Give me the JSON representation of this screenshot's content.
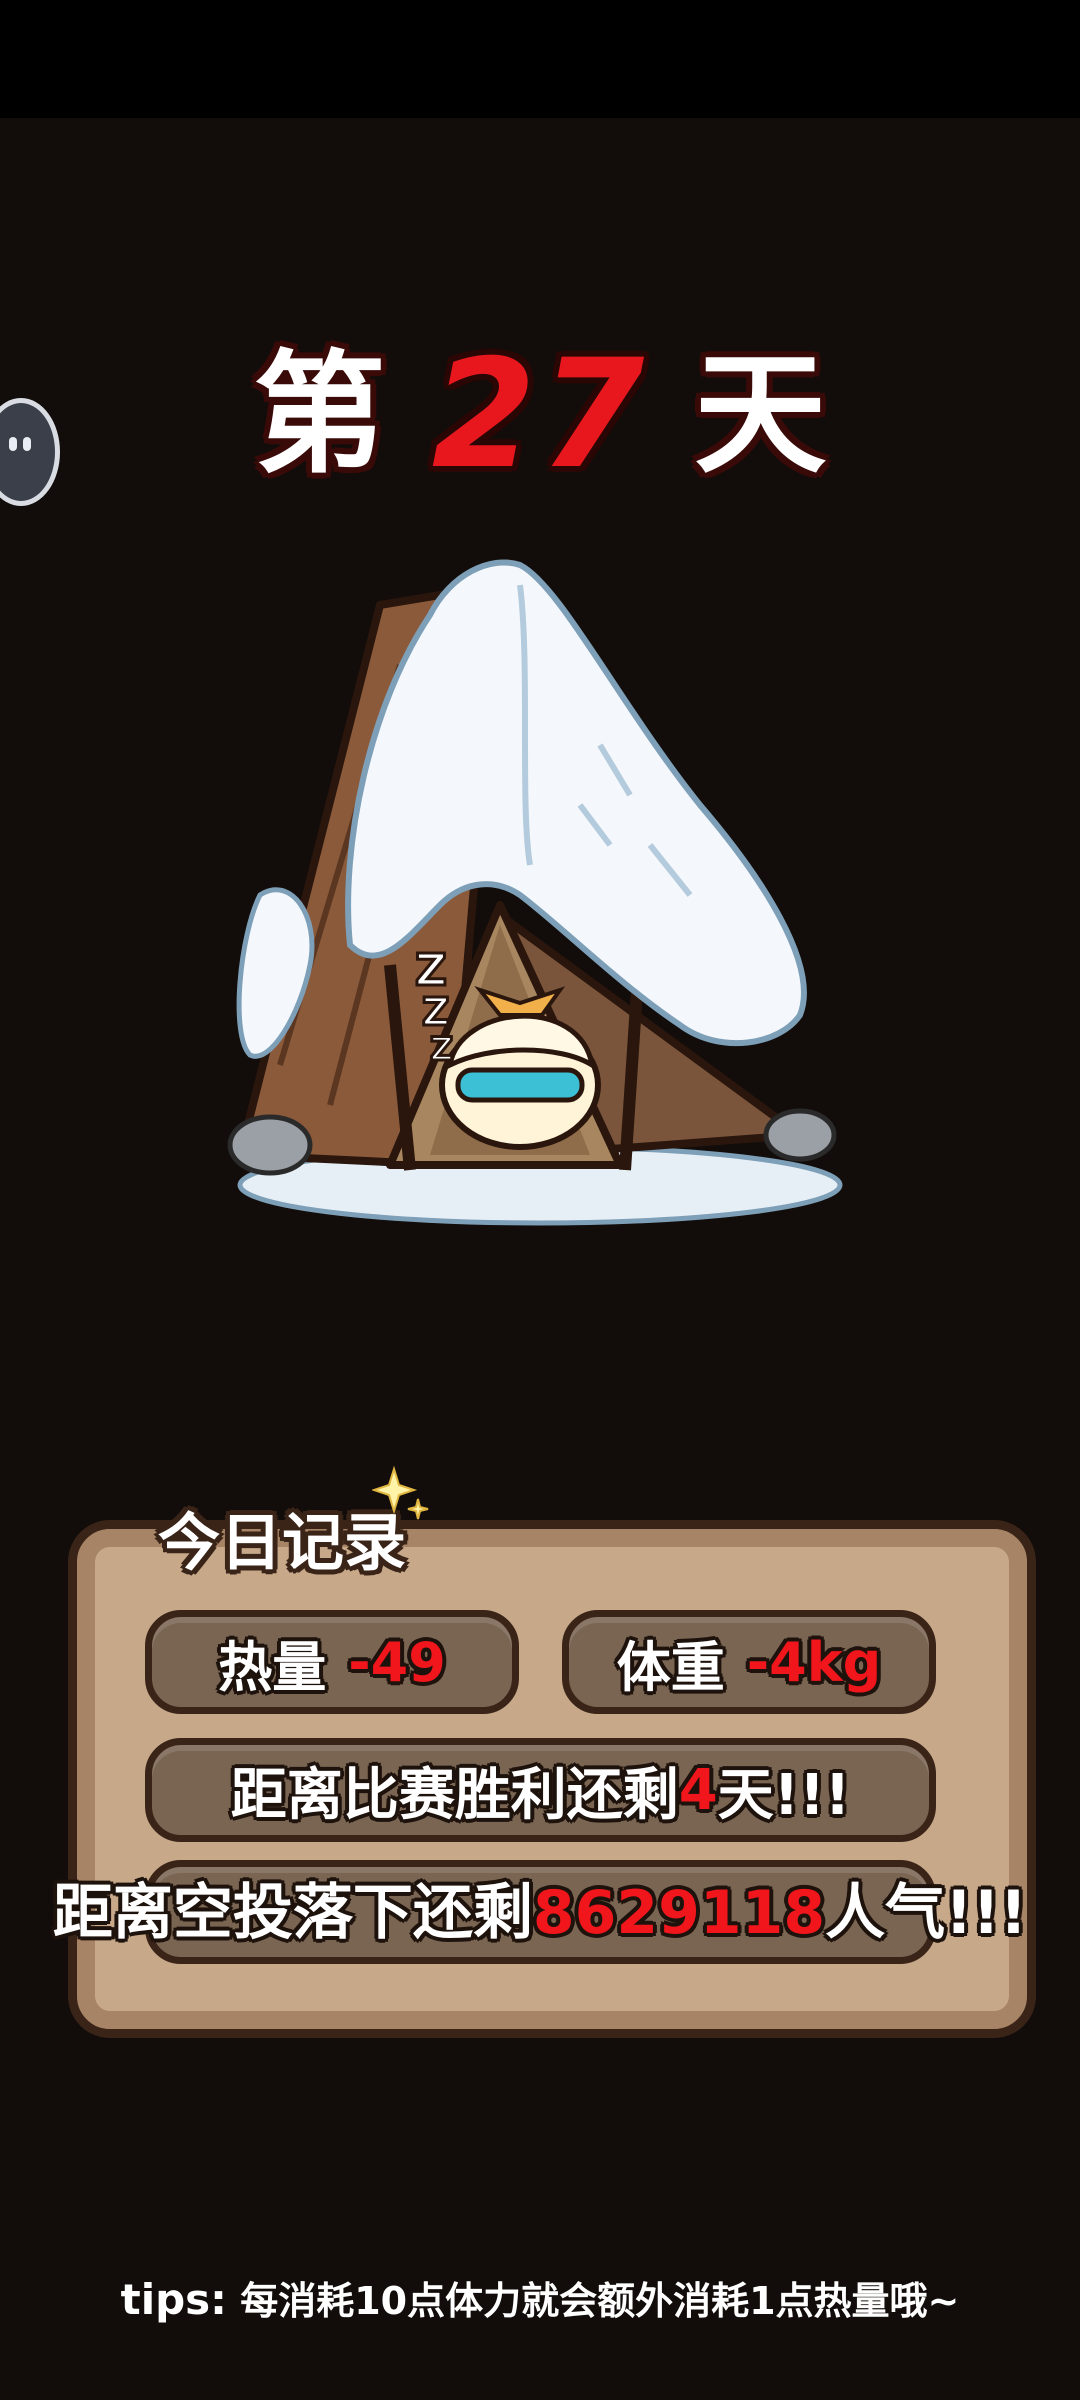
{
  "title": {
    "prefix": "第",
    "day": "27",
    "suffix": "天"
  },
  "record": {
    "heading": "今日记录",
    "calorie_label": "热量",
    "calorie_value": "-49",
    "weight_label": "体重",
    "weight_value": "-4kg",
    "victory_prefix": "距离比赛胜利还剩",
    "victory_days": "4",
    "victory_suffix": "天!!!",
    "airdrop_prefix": "距离空投落下还剩",
    "airdrop_value": "8629118",
    "airdrop_suffix": "人气!!!"
  },
  "tips": {
    "label": "tips:",
    "text": "每消耗10点体力就会额外消耗1点热量哦~"
  },
  "colors": {
    "background": "#120d0a",
    "accent_red": "#f0161c",
    "panel": "#c7a98a",
    "pill": "#7a6552"
  }
}
